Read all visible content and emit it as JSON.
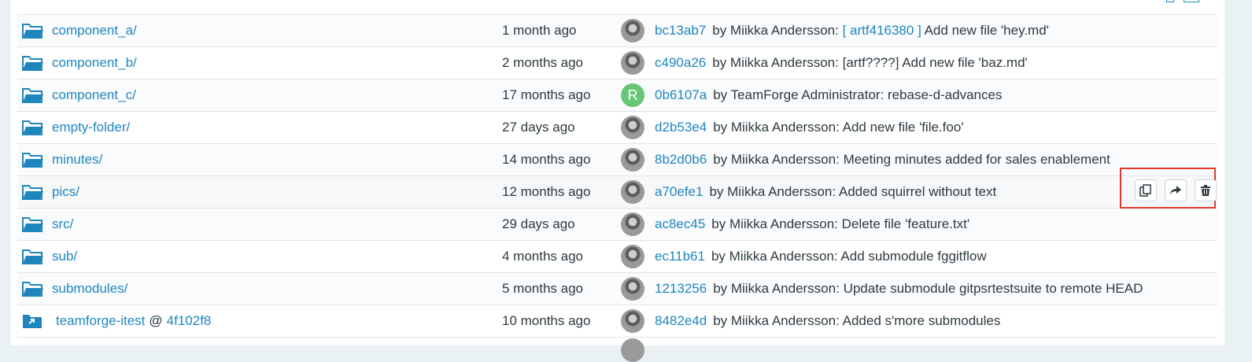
{
  "rows": [
    {
      "name": "component_a/",
      "icon": "folder-icon",
      "date": "1 month ago",
      "avatar": "photo",
      "hash": "bc13ab7",
      "author": "by Miikka Andersson:",
      "msg_link": "[ artf416380 ]",
      "msg": "Add new file 'hey.md'"
    },
    {
      "name": "component_b/",
      "icon": "folder-icon",
      "date": "2 months ago",
      "avatar": "photo",
      "hash": "c490a26",
      "author": "by Miikka Andersson:",
      "msg_link": "",
      "msg": "[artf????] Add new file 'baz.md'"
    },
    {
      "name": "component_c/",
      "icon": "folder-icon",
      "date": "17 months ago",
      "avatar": "letter",
      "avatar_letter": "R",
      "hash": "0b6107a",
      "author": "by TeamForge Administrator:",
      "msg_link": "",
      "msg": "rebase-d-advances"
    },
    {
      "name": "empty-folder/",
      "icon": "folder-icon",
      "date": "27 days ago",
      "avatar": "photo",
      "hash": "d2b53e4",
      "author": "by Miikka Andersson:",
      "msg_link": "",
      "msg": "Add new file 'file.foo'"
    },
    {
      "name": "minutes/",
      "icon": "folder-icon",
      "date": "14 months ago",
      "avatar": "photo",
      "hash": "8b2d0b6",
      "author": "by Miikka Andersson:",
      "msg_link": "",
      "msg": "Meeting minutes added for sales enablement"
    },
    {
      "name": "pics/",
      "icon": "folder-icon",
      "date": "12 months ago",
      "avatar": "photo",
      "hash": "a70efe1",
      "author": "by Miikka Andersson:",
      "msg_link": "",
      "msg": "Added squirrel without text"
    },
    {
      "name": "src/",
      "icon": "folder-icon",
      "date": "29 days ago",
      "avatar": "photo",
      "hash": "ac8ec45",
      "author": "by Miikka Andersson:",
      "msg_link": "",
      "msg": "Delete file 'feature.txt'"
    },
    {
      "name": "sub/",
      "icon": "folder-icon",
      "date": "4 months ago",
      "avatar": "photo",
      "hash": "ec11b61",
      "author": "by Miikka Andersson:",
      "msg_link": "",
      "msg": "Add submodule fggitflow"
    },
    {
      "name": "submodules/",
      "icon": "folder-icon",
      "date": "5 months ago",
      "avatar": "photo",
      "hash": "1213256",
      "author": "by Miikka Andersson:",
      "msg_link": "",
      "msg": "Update submodule gitpsrtestsuite to remote HEAD"
    },
    {
      "name": "teamforge-itest",
      "icon": "submodule-icon",
      "at": "@",
      "sub_ref": "4f102f8",
      "date": "10 months ago",
      "avatar": "photo",
      "hash": "8482e4d",
      "author": "by Miikka Andersson:",
      "msg_link": "",
      "msg": "Added s'more submodules"
    }
  ],
  "row_actions": {
    "copy_icon": "copy-icon",
    "share_icon": "share-icon",
    "delete_icon": "trash-icon"
  },
  "colors": {
    "link": "#1f86bd",
    "text": "#2d3a40",
    "highlight": "#e23b2c"
  }
}
